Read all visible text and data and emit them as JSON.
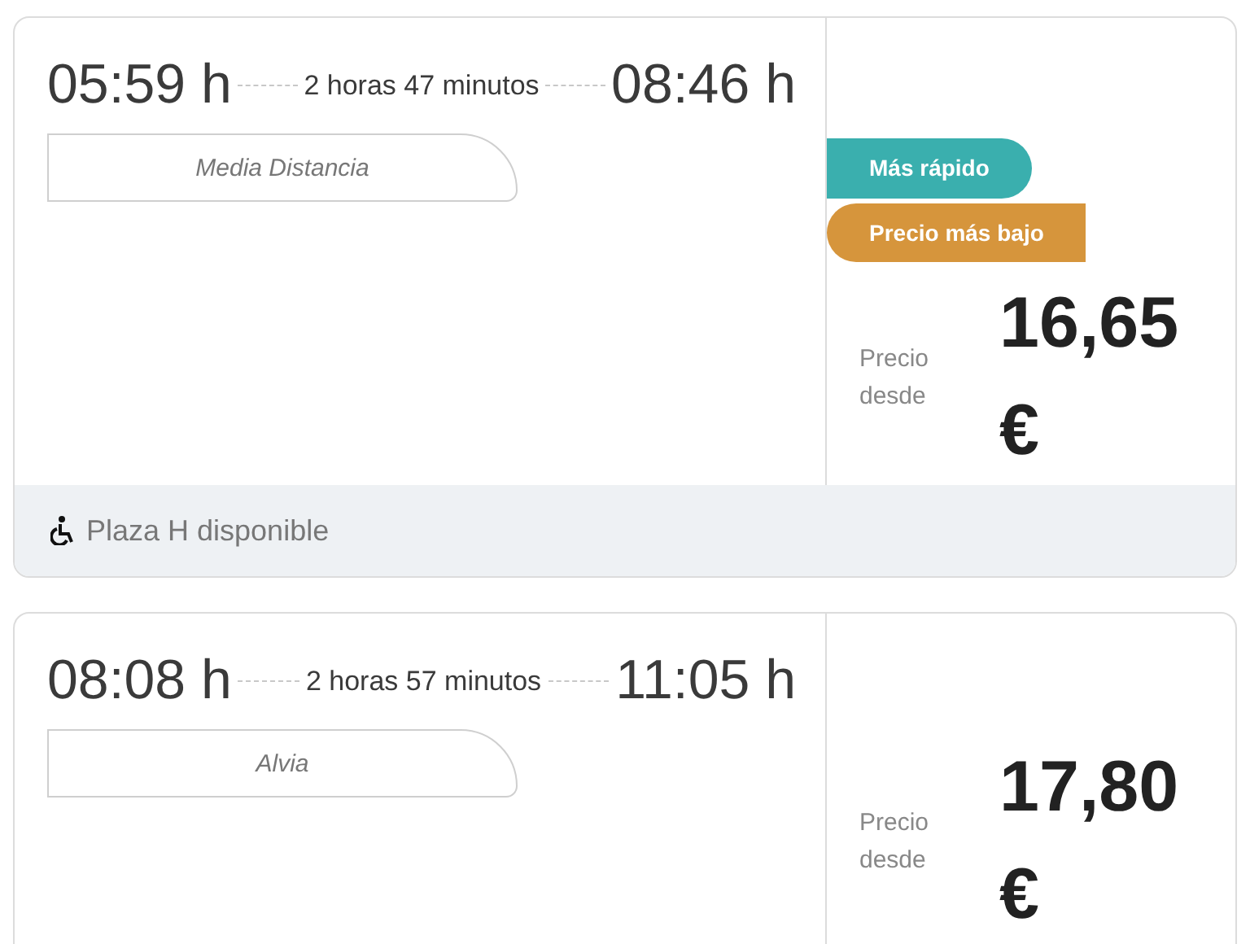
{
  "trips": [
    {
      "departure": "05:59 h",
      "duration": "2 horas 47 minutos",
      "arrival": "08:46 h",
      "train": "Media Distancia",
      "badges": [
        {
          "label": "Más rápido",
          "kind": "fastest",
          "color": "#3aafae"
        },
        {
          "label": "Precio más bajo",
          "kind": "cheapest",
          "color": "#d6953c"
        }
      ],
      "price_label": "Precio desde",
      "price": "16,65",
      "currency": "€",
      "footer": "Plaza H disponible"
    },
    {
      "departure": "08:08 h",
      "duration": "2 horas 57 minutos",
      "arrival": "11:05 h",
      "train": "Alvia",
      "price_label": "Precio desde",
      "price": "17,80",
      "currency": "€"
    }
  ]
}
